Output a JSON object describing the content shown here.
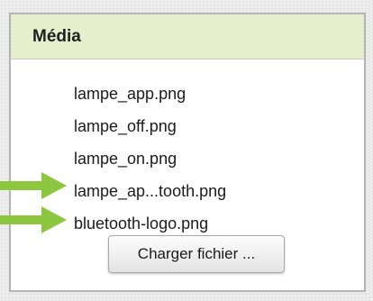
{
  "panel": {
    "title": "Média",
    "header_color": "#e5eecd"
  },
  "media": {
    "files": [
      "lampe_app.png",
      "lampe_off.png",
      "lampe_on.png",
      "lampe_ap...tooth.png",
      "bluetooth-logo.png"
    ],
    "upload_label": "Charger fichier ..."
  },
  "annotations": {
    "arrow_color": "#8dc63f",
    "arrow_icon": "arrow-right-icon"
  }
}
